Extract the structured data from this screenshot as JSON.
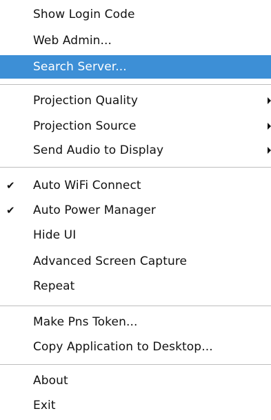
{
  "menu": {
    "items": [
      {
        "label": "Show Login Code"
      },
      {
        "label": "Web Admin..."
      },
      {
        "label": "Search Server...",
        "state": "highlighted"
      },
      {
        "label": "Projection Quality",
        "submenu": true
      },
      {
        "label": "Projection Source",
        "submenu": true
      },
      {
        "label": "Send Audio to Display",
        "submenu": true
      },
      {
        "label": "Auto WiFi Connect",
        "checked": true
      },
      {
        "label": "Auto Power Manager",
        "checked": true
      },
      {
        "label": "Hide UI"
      },
      {
        "label": "Advanced Screen Capture"
      },
      {
        "label": "Repeat"
      },
      {
        "label": "Make Pns Token..."
      },
      {
        "label": "Copy Application to Desktop..."
      },
      {
        "label": "About"
      },
      {
        "label": "Exit"
      }
    ],
    "check_glyph": "✔",
    "highlight_color": "#3d8fd6"
  }
}
